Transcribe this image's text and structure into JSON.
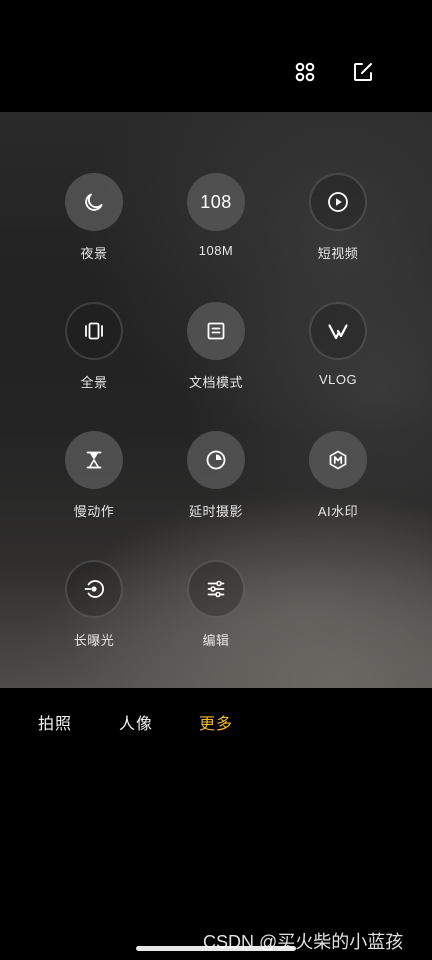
{
  "top_bar": {
    "grid_icon": "grid-icon",
    "edit_icon": "edit-icon"
  },
  "modes": [
    {
      "label": "夜景",
      "icon": "moon-icon",
      "style": "filled"
    },
    {
      "label": "108M",
      "icon_text": "108",
      "style": "filled"
    },
    {
      "label": "短视频",
      "icon": "play-icon",
      "style": "outline"
    },
    {
      "label": "全景",
      "icon": "panorama-icon",
      "style": "outline"
    },
    {
      "label": "文档模式",
      "icon": "document-icon",
      "style": "filled"
    },
    {
      "label": "VLOG",
      "icon": "vlog-icon",
      "style": "outline"
    },
    {
      "label": "慢动作",
      "icon": "hourglass-icon",
      "style": "filled"
    },
    {
      "label": "延时摄影",
      "icon": "timelapse-icon",
      "style": "filled"
    },
    {
      "label": "AI水印",
      "icon": "watermark-icon",
      "style": "filled"
    },
    {
      "label": "长曝光",
      "icon": "long-exposure-icon",
      "style": "outline"
    },
    {
      "label": "编辑",
      "icon": "sliders-icon",
      "style": "outline"
    }
  ],
  "tabs": [
    {
      "label": "拍照",
      "active": false
    },
    {
      "label": "人像",
      "active": false
    },
    {
      "label": "更多",
      "active": true
    }
  ],
  "colors": {
    "active_tab": "#f2b731",
    "background": "#000000"
  },
  "watermark": "CSDN @买火柴的小蓝孩"
}
